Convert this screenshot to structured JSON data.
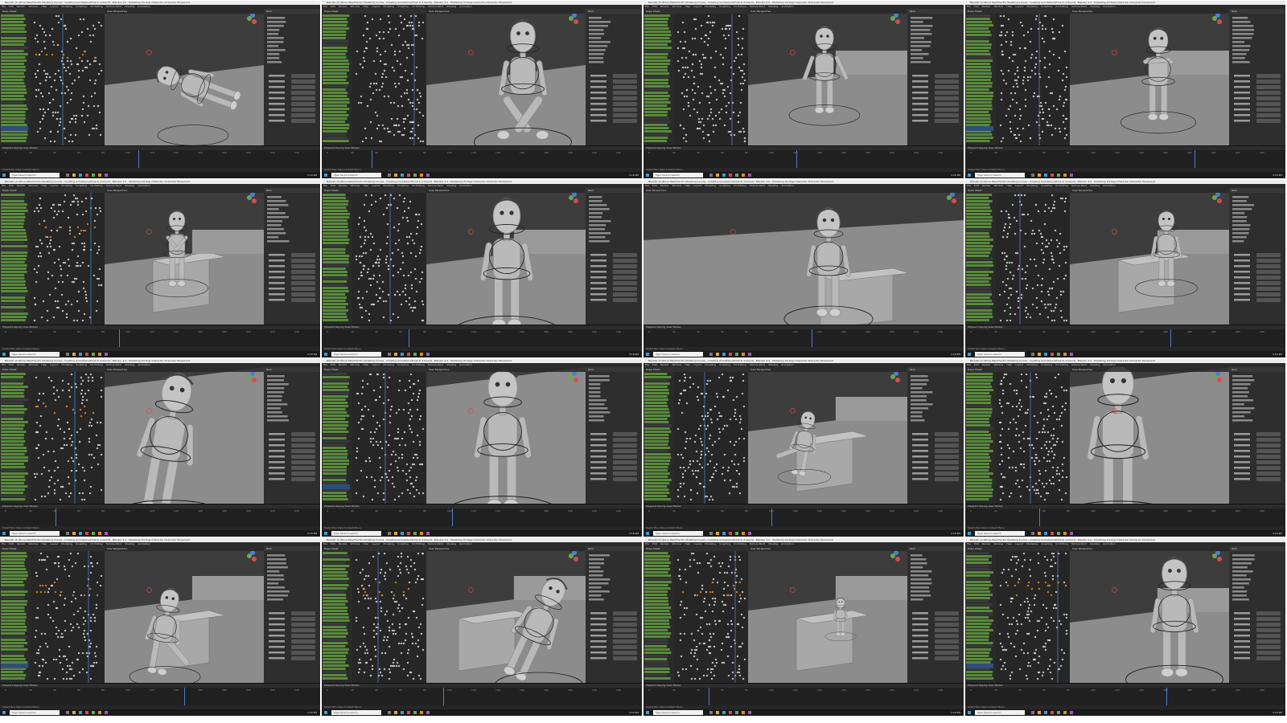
{
  "window_title": "Blender [C:\\Drive files\\The Pro Modeling Course - Creating Animations\\Pro\\4.2\\ 2.blend] - Blender 4.0 - Modelling Via Rigs Character Character Movement",
  "menus": [
    "File",
    "Edit",
    "Render",
    "Window",
    "Help",
    "Layout",
    "Modeling",
    "Sculpting",
    "UV Editing",
    "Texture Paint",
    "Shading",
    "Animation"
  ],
  "outliner_label": "Dope Sheet",
  "viewport_label": "User Perspective",
  "properties_label": "Item",
  "timeline_label": "Playback  Keying  View  Marker",
  "timeline_frames": [
    "0",
    "20",
    "40",
    "60",
    "80",
    "100",
    "120",
    "140",
    "160",
    "180",
    "200",
    "220",
    "240"
  ],
  "status_text": "Select  Pan View  Context Menu",
  "taskbar_search": "Type here to search",
  "taskbar_clock": "3:18 PM",
  "colors": {
    "background": "#ffffff",
    "editor_dark": "#242424",
    "viewport_gray": "#3d3d3d",
    "floor_gray": "#8c8c8c",
    "channel_green": "#5a8a3c",
    "keyframe_white": "#d8d8d8",
    "keyframe_orange": "#e58a24",
    "selection_blue": "#4a7fd1",
    "taskbar": "#1a1a1a"
  },
  "tiles": [
    {
      "pose": "lying"
    },
    {
      "pose": "sitting"
    },
    {
      "pose": "standing"
    },
    {
      "pose": "t-pose"
    },
    {
      "pose": "box-stand"
    },
    {
      "pose": "closeup-stand"
    },
    {
      "pose": "wide-box",
      "layout": "wide"
    },
    {
      "pose": "behind-box"
    },
    {
      "pose": "crouch-closeup"
    },
    {
      "pose": "top-down"
    },
    {
      "pose": "kneel"
    },
    {
      "pose": "hand-closeup"
    },
    {
      "pose": "crouch-side"
    },
    {
      "pose": "climb"
    },
    {
      "pose": "far-on-box"
    },
    {
      "pose": "standing-final"
    }
  ]
}
